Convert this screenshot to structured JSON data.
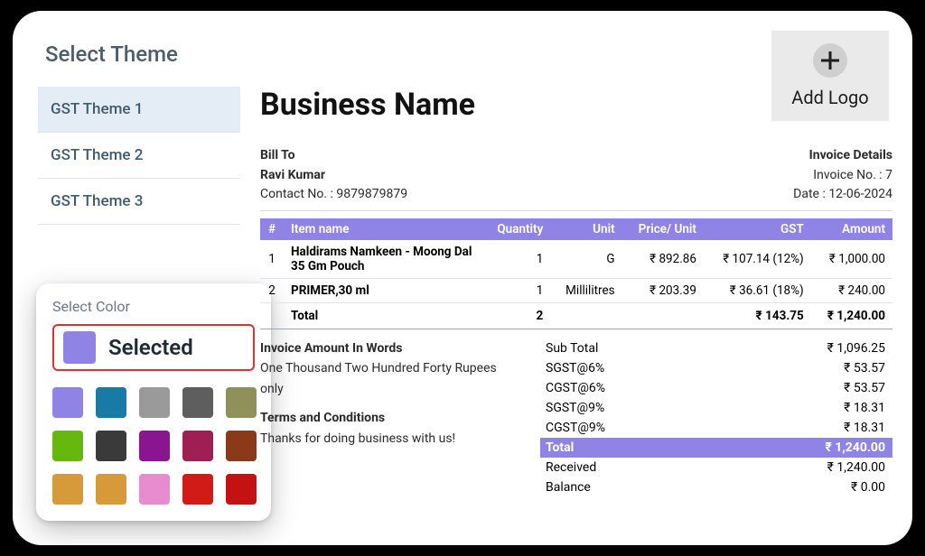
{
  "accent_color": "#8f84e6",
  "sidebar": {
    "title": "Select Theme",
    "themes": [
      "GST Theme 1",
      "GST Theme 2",
      "GST Theme 3"
    ],
    "active_index": 0
  },
  "color_picker": {
    "title": "Select Color",
    "selected_label": "Selected",
    "selected_color": "#8f84e6",
    "swatches": [
      "#8f84e6",
      "#1a7aa6",
      "#9a9a9a",
      "#5e5e5e",
      "#8f915a",
      "#66b80e",
      "#3a3a3a",
      "#8a1590",
      "#9f1f52",
      "#8a3a19",
      "#d69a3a",
      "#d69a3a",
      "#e88cd0",
      "#d11b17",
      "#c41111"
    ]
  },
  "invoice": {
    "business_name": "Business Name",
    "add_logo_label": "Add Logo",
    "bill_to_label": "Bill To",
    "customer_name": "Ravi Kumar",
    "contact_line": "Contact No. : 9879879879",
    "details_label": "Invoice Details",
    "invoice_no_line": "Invoice No. : 7",
    "date_line": "Date : 12-06-2024",
    "headers": {
      "idx": "#",
      "name": "Item name",
      "qty": "Quantity",
      "unit": "Unit",
      "price": "Price/ Unit",
      "gst": "GST",
      "amount": "Amount"
    },
    "items": [
      {
        "idx": "1",
        "name": "Haldirams Namkeen - Moong Dal 35 Gm Pouch",
        "qty": "1",
        "unit": "G",
        "price": "₹ 892.86",
        "gst": "₹ 107.14 (12%)",
        "amount": "₹ 1,000.00"
      },
      {
        "idx": "2",
        "name": "PRIMER,30 ml",
        "qty": "1",
        "unit": "Millilitres",
        "price": "₹ 203.39",
        "gst": "₹ 36.61 (18%)",
        "amount": "₹ 240.00"
      }
    ],
    "items_total": {
      "label": "Total",
      "qty": "2",
      "gst": "₹ 143.75",
      "amount": "₹ 1,240.00"
    },
    "words_label": "Invoice Amount In Words",
    "words_value": "One Thousand Two Hundred Forty Rupees only",
    "terms_label": "Terms and Conditions",
    "terms_value": "Thanks for doing business with us!",
    "summary": [
      {
        "label": "Sub Total",
        "value": "₹ 1,096.25"
      },
      {
        "label": "SGST@6%",
        "value": "₹ 53.57"
      },
      {
        "label": "CGST@6%",
        "value": "₹ 53.57"
      },
      {
        "label": "SGST@9%",
        "value": "₹ 18.31"
      },
      {
        "label": "CGST@9%",
        "value": "₹ 18.31"
      }
    ],
    "grand_total": {
      "label": "Total",
      "value": "₹ 1,240.00"
    },
    "after_total": [
      {
        "label": "Received",
        "value": "₹ 1,240.00"
      },
      {
        "label": "Balance",
        "value": "₹ 0.00"
      }
    ]
  }
}
